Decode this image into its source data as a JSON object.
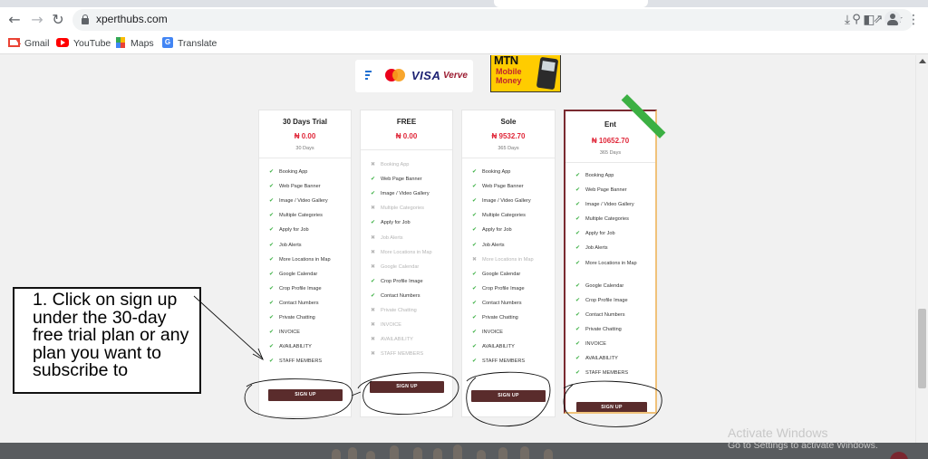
{
  "browser": {
    "url": "xperthubs.com",
    "bookmarks": [
      {
        "label": "Gmail",
        "icon": "gmail-icon"
      },
      {
        "label": "YouTube",
        "icon": "youtube-icon"
      },
      {
        "label": "Maps",
        "icon": "maps-icon"
      },
      {
        "label": "Translate",
        "icon": "translate-icon"
      }
    ]
  },
  "payments": {
    "visa": "VISA",
    "verve": "Verve",
    "mtn_word": "MTN",
    "mtn_line1": "Mobile",
    "mtn_line2": "Money"
  },
  "plans": [
    {
      "name": "30 Days Trial",
      "price": "₦ 0.00",
      "duration": "30 Days",
      "signup": "SIGN UP",
      "features": [
        {
          "label": "Booking App",
          "on": true
        },
        {
          "label": "Web Page Banner",
          "on": true
        },
        {
          "label": "Image / Video Gallery",
          "on": true
        },
        {
          "label": "Multiple Categories",
          "on": true
        },
        {
          "label": "Apply for Job",
          "on": true
        },
        {
          "label": "Job Alerts",
          "on": true
        },
        {
          "label": "More Locations in Map",
          "on": true
        },
        {
          "label": "Google Calendar",
          "on": true
        },
        {
          "label": "Crop Profile Image",
          "on": true
        },
        {
          "label": "Contact Numbers",
          "on": true
        },
        {
          "label": "Private Chatting",
          "on": true
        },
        {
          "label": "INVOICE",
          "on": true
        },
        {
          "label": "AVAILABILITY",
          "on": true
        },
        {
          "label": "STAFF MEMBERS",
          "on": true
        }
      ]
    },
    {
      "name": "FREE",
      "price": "₦ 0.00",
      "duration": "",
      "signup": "SIGN UP",
      "features": [
        {
          "label": "Booking App",
          "on": false
        },
        {
          "label": "Web Page Banner",
          "on": true
        },
        {
          "label": "Image / Video Gallery",
          "on": true
        },
        {
          "label": "Multiple Categories",
          "on": false
        },
        {
          "label": "Apply for Job",
          "on": true
        },
        {
          "label": "Job Alerts",
          "on": false
        },
        {
          "label": "More Locations in Map",
          "on": false
        },
        {
          "label": "Google Calendar",
          "on": false
        },
        {
          "label": "Crop Profile Image",
          "on": true
        },
        {
          "label": "Contact Numbers",
          "on": true
        },
        {
          "label": "Private Chatting",
          "on": false
        },
        {
          "label": "INVOICE",
          "on": false
        },
        {
          "label": "AVAILABILITY",
          "on": false
        },
        {
          "label": "STAFF MEMBERS",
          "on": false
        }
      ]
    },
    {
      "name": "Sole",
      "price": "₦ 9532.70",
      "duration": "365 Days",
      "signup": "SIGN UP",
      "features": [
        {
          "label": "Booking App",
          "on": true
        },
        {
          "label": "Web Page Banner",
          "on": true
        },
        {
          "label": "Image / Video Gallery",
          "on": true
        },
        {
          "label": "Multiple Categories",
          "on": true
        },
        {
          "label": "Apply for Job",
          "on": true
        },
        {
          "label": "Job Alerts",
          "on": true
        },
        {
          "label": "More Locations in Map",
          "on": false
        },
        {
          "label": "Google Calendar",
          "on": true
        },
        {
          "label": "Crop Profile Image",
          "on": true
        },
        {
          "label": "Contact Numbers",
          "on": true
        },
        {
          "label": "Private Chatting",
          "on": true
        },
        {
          "label": "INVOICE",
          "on": true
        },
        {
          "label": "AVAILABILITY",
          "on": true
        },
        {
          "label": "STAFF MEMBERS",
          "on": true
        }
      ]
    },
    {
      "name": "Ent",
      "price": "₦ 10652.70",
      "duration": "365 Days",
      "signup": "SIGN UP",
      "features": [
        {
          "label": "Booking App",
          "on": true
        },
        {
          "label": "Web Page Banner",
          "on": true
        },
        {
          "label": "Image / Video Gallery",
          "on": true
        },
        {
          "label": "Multiple Categories",
          "on": true
        },
        {
          "label": "Apply for Job",
          "on": true
        },
        {
          "label": "Job Alerts",
          "on": true
        },
        {
          "label": "More Locations in Map",
          "on": true
        },
        {
          "label": "Google Calendar",
          "on": true
        },
        {
          "label": "Crop Profile Image",
          "on": true
        },
        {
          "label": "Contact Numbers",
          "on": true
        },
        {
          "label": "Private Chatting",
          "on": true
        },
        {
          "label": "INVOICE",
          "on": true
        },
        {
          "label": "AVAILABILITY",
          "on": true
        },
        {
          "label": "STAFF MEMBERS",
          "on": true
        }
      ]
    }
  ],
  "annotation": {
    "text": "1. Click on sign up under the 30-day free trial plan or any plan you want to subscribe to"
  },
  "windows_watermark": {
    "line1": "Activate Windows",
    "line2": "Go to Settings to activate Windows."
  },
  "colors": {
    "price_red": "#e0283a",
    "check_green": "#3cb043",
    "signup_bg": "#5a2c2c",
    "featured_border": "#7a2a30",
    "featured_accent": "#f0c27a"
  }
}
